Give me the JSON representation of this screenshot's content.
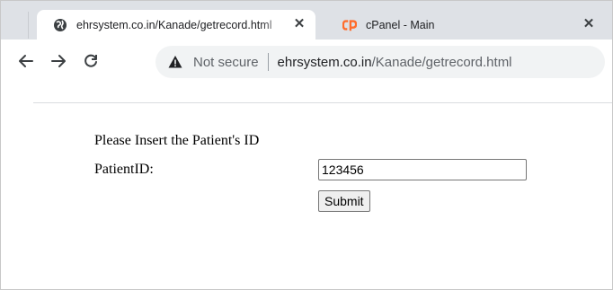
{
  "tabs": [
    {
      "title": "ehrsystem.co.in/Kanade/getrecord.html",
      "favicon": "globe-icon",
      "active": true,
      "close": "✕"
    },
    {
      "title": "cPanel - Main",
      "favicon": "cpanel-icon",
      "active": false,
      "close": "✕"
    }
  ],
  "toolbar": {
    "security_label": "Not secure",
    "url_domain": "ehrsystem.co.in",
    "url_path": "/Kanade/getrecord.html"
  },
  "form": {
    "prompt": "Please Insert the Patient's ID",
    "field_label": "PatientID:",
    "field_value": "123456",
    "submit_label": "Submit"
  },
  "colors": {
    "tabstrip": "#dee1e6",
    "cpanel_orange": "#ff6c2c",
    "omnibox": "#f1f3f4"
  }
}
